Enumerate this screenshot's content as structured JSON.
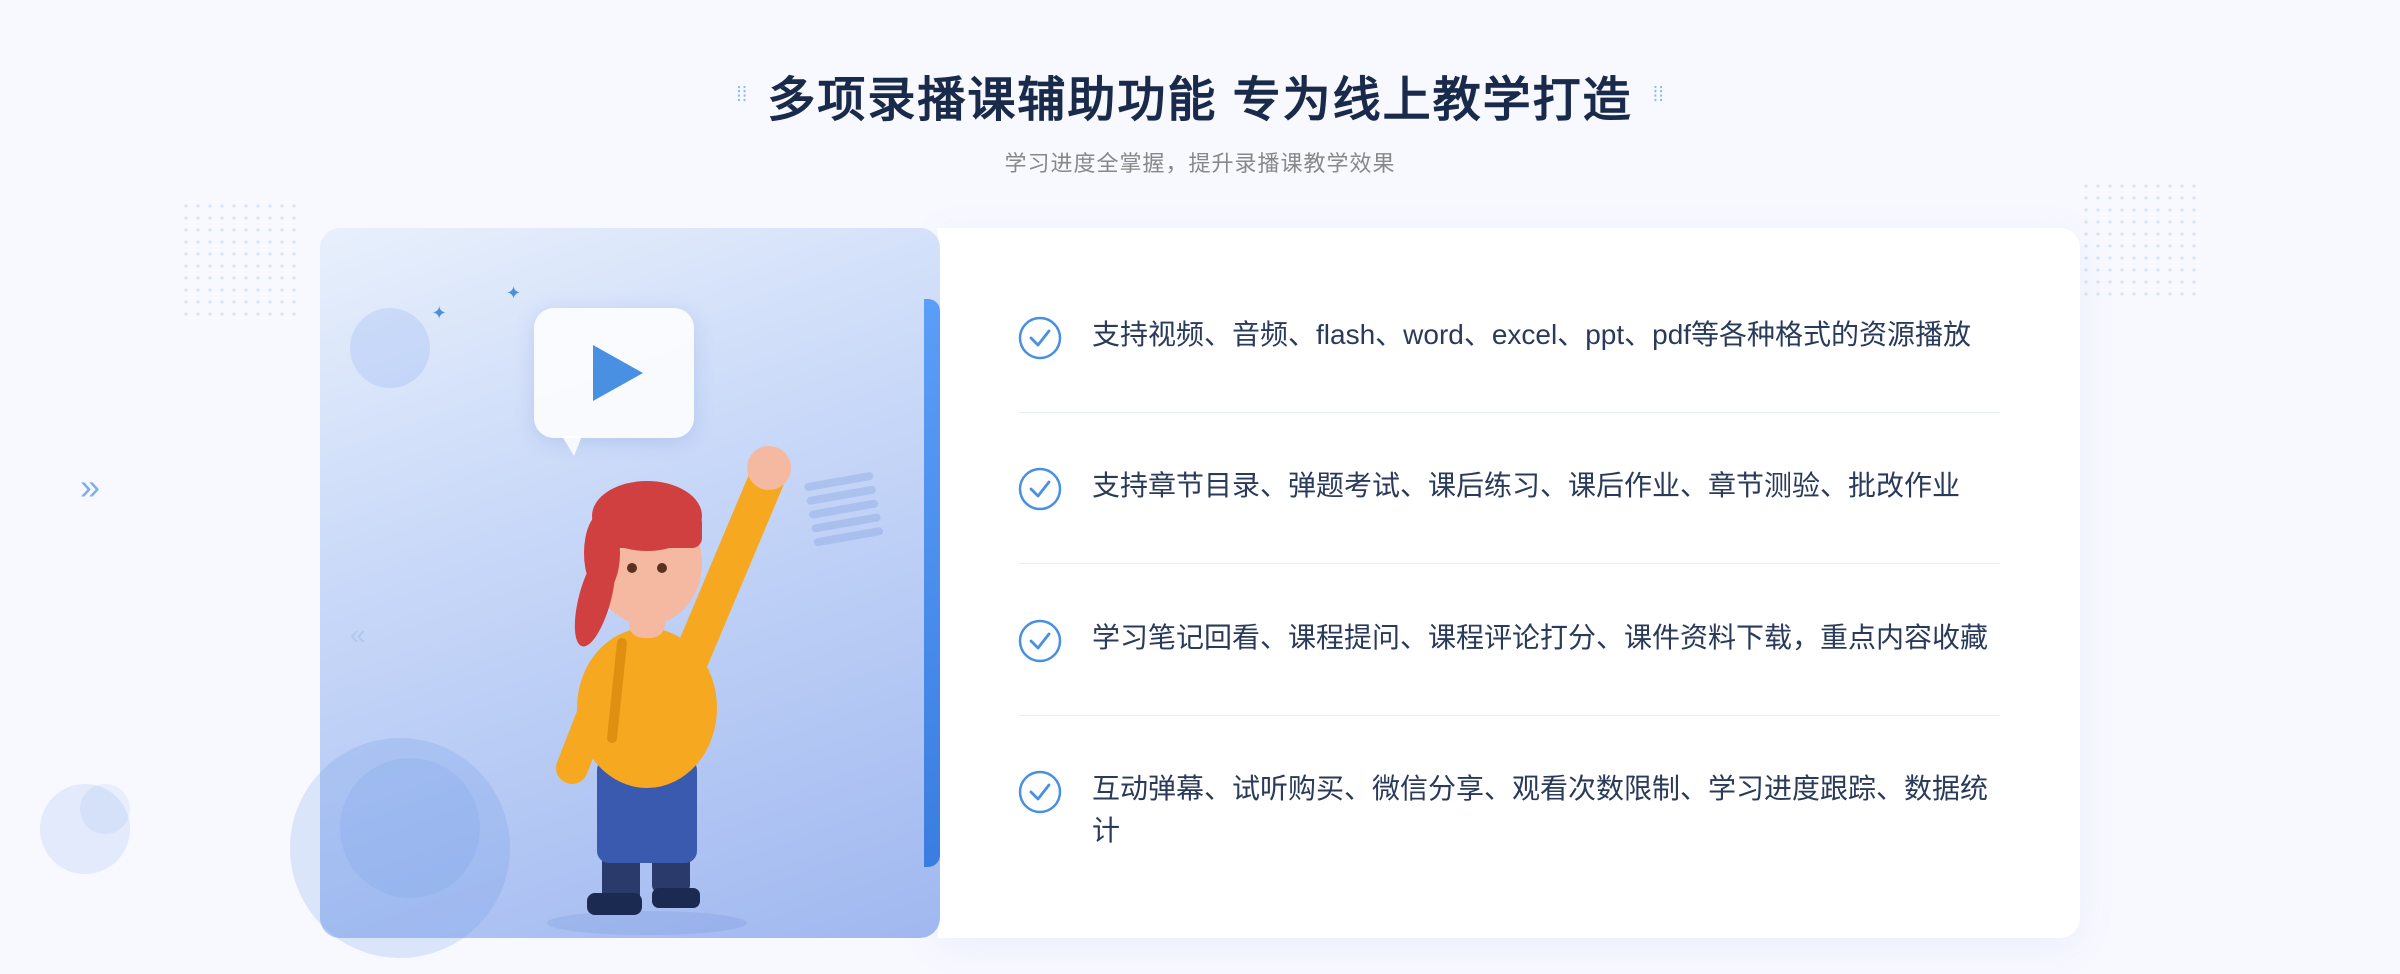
{
  "page": {
    "background_color": "#f5f7ff"
  },
  "header": {
    "title": "多项录播课辅助功能 专为线上教学打造",
    "subtitle": "学习进度全掌握，提升录播课教学效果",
    "dots_left": "⁞⁞",
    "dots_right": "⁞⁞"
  },
  "features": [
    {
      "id": 1,
      "text": "支持视频、音频、flash、word、excel、ppt、pdf等各种格式的资源播放"
    },
    {
      "id": 2,
      "text": "支持章节目录、弹题考试、课后练习、课后作业、章节测验、批改作业"
    },
    {
      "id": 3,
      "text": "学习笔记回看、课程提问、课程评论打分、课件资料下载，重点内容收藏"
    },
    {
      "id": 4,
      "text": "互动弹幕、试听购买、微信分享、观看次数限制、学习进度跟踪、数据统计"
    }
  ],
  "icons": {
    "chevron_left": "»",
    "chevron_left2": "«",
    "play": "▶",
    "check": "check-circle"
  },
  "colors": {
    "primary_blue": "#4a90e2",
    "dark_text": "#1a2a4a",
    "light_text": "#888888",
    "feature_text": "#2a3a5a",
    "bg_gradient_start": "#e8f0fc",
    "bg_gradient_end": "#a0b8f0"
  }
}
